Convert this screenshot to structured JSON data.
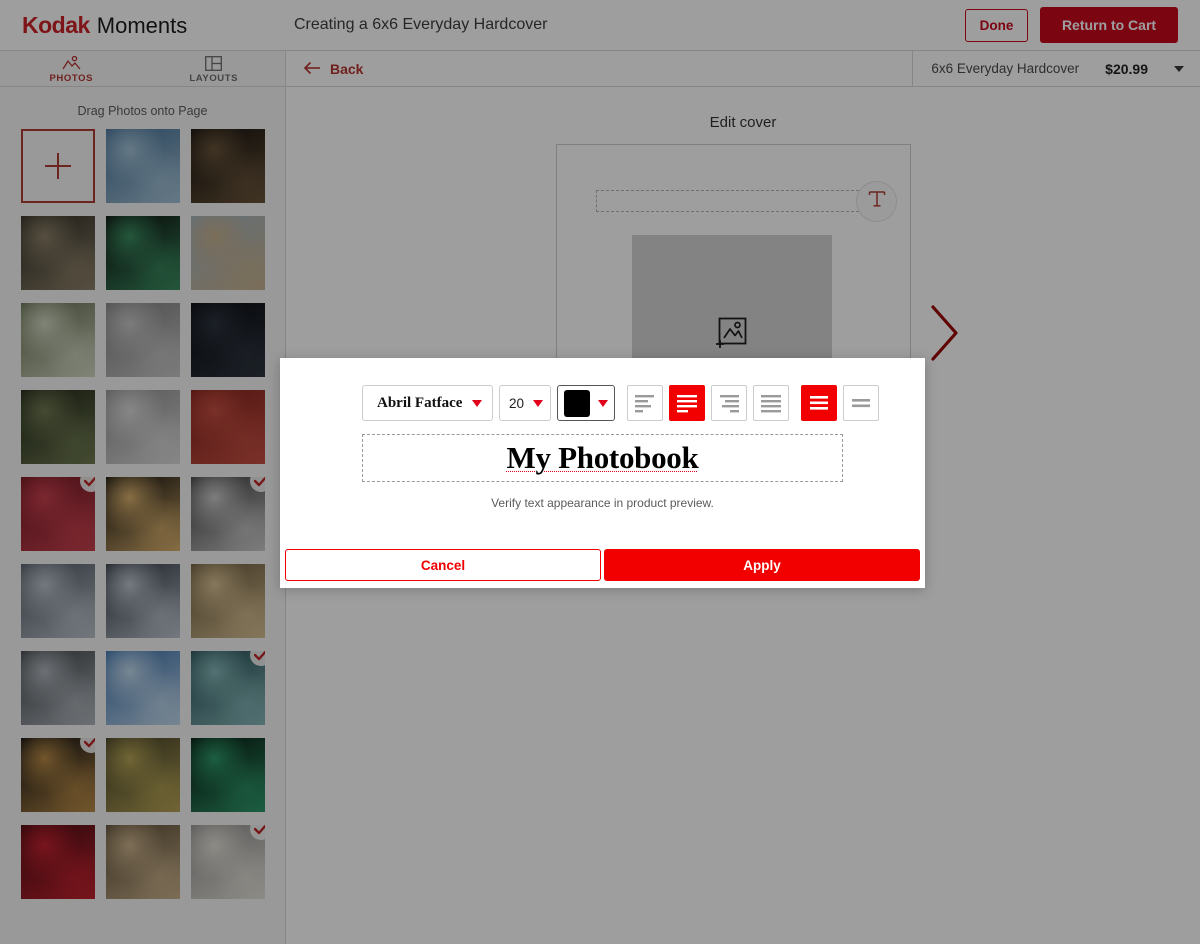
{
  "header": {
    "brand_primary": "Kodak",
    "brand_secondary": "Moments",
    "title": "Creating a 6x6 Everyday Hardcover",
    "done_label": "Done",
    "cart_label": "Return to Cart",
    "accent_red": "#e2001a"
  },
  "sidebar": {
    "tabs": [
      {
        "label": "PHOTOS",
        "icon": "photos-icon",
        "active": true
      },
      {
        "label": "LAYOUTS",
        "icon": "layouts-icon",
        "active": false
      }
    ],
    "drag_hint": "Drag Photos onto Page",
    "add_tile_icon": "plus-icon",
    "thumbnails": [
      {
        "name": "add-photos-tile",
        "kind": "add",
        "used": false
      },
      {
        "name": "thumb-blue-mosaic",
        "kind": "photo",
        "used": false,
        "c1": "#3b6e9c",
        "c2": "#9dc2da",
        "style": "noise-blue"
      },
      {
        "name": "thumb-city-skyline-night",
        "kind": "photo",
        "used": false,
        "c1": "#120e0c",
        "c2": "#6b5334",
        "style": "city-night"
      },
      {
        "name": "thumb-guitar-hands",
        "kind": "photo",
        "used": false,
        "c1": "#2e2a22",
        "c2": "#8d7f63",
        "style": "guitar"
      },
      {
        "name": "thumb-green-bokeh",
        "kind": "photo",
        "used": false,
        "c1": "#0a0a0a",
        "c2": "#2f8f5b",
        "style": "bokeh-green"
      },
      {
        "name": "thumb-horse-mane",
        "kind": "photo",
        "used": false,
        "c1": "#9fb6c4",
        "c2": "#c9b089",
        "style": "horse"
      },
      {
        "name": "thumb-dandelion",
        "kind": "photo",
        "used": false,
        "c1": "#5f6b4a",
        "c2": "#cfd6bd",
        "style": "dandelion"
      },
      {
        "name": "thumb-heart-sculpture",
        "kind": "photo",
        "used": false,
        "c1": "#7d7d7d",
        "c2": "#c6c6c6",
        "style": "hearts"
      },
      {
        "name": "thumb-dark-portrait",
        "kind": "photo",
        "used": false,
        "c1": "#07090f",
        "c2": "#2b3440",
        "style": "dark"
      },
      {
        "name": "thumb-forest-path",
        "kind": "photo",
        "used": false,
        "c1": "#1c2414",
        "c2": "#6d7a4a",
        "style": "forest"
      },
      {
        "name": "thumb-wind-turbines",
        "kind": "photo",
        "used": false,
        "c1": "#8c8c8c",
        "c2": "#d9d9d9",
        "style": "turbines"
      },
      {
        "name": "thumb-red-door",
        "kind": "photo",
        "used": false,
        "c1": "#8f1d18",
        "c2": "#d44a3a",
        "style": "reddoor"
      },
      {
        "name": "thumb-red-texture",
        "kind": "photo",
        "used": true,
        "c1": "#7d1320",
        "c2": "#d93a4a",
        "style": "redtex"
      },
      {
        "name": "thumb-warm-bokeh",
        "kind": "photo",
        "used": false,
        "c1": "#0c0c0c",
        "c2": "#e0b060",
        "style": "bokeh-warm"
      },
      {
        "name": "thumb-elder-portrait",
        "kind": "photo",
        "used": true,
        "c1": "#3a3a3a",
        "c2": "#c9c9c9",
        "style": "gray"
      },
      {
        "name": "thumb-space-needle",
        "kind": "photo",
        "used": false,
        "c1": "#4a5560",
        "c2": "#b8c2cc",
        "style": "needle"
      },
      {
        "name": "thumb-woman-stripes",
        "kind": "photo",
        "used": false,
        "c1": "#2c3540",
        "c2": "#b9c4cf",
        "style": "stripes"
      },
      {
        "name": "thumb-food-board",
        "kind": "photo",
        "used": false,
        "c1": "#6b5433",
        "c2": "#d9c08a",
        "style": "food"
      },
      {
        "name": "thumb-open-road",
        "kind": "photo",
        "used": false,
        "c1": "#3a3f45",
        "c2": "#aeb6bd",
        "style": "road"
      },
      {
        "name": "thumb-blue-sky",
        "kind": "photo",
        "used": false,
        "c1": "#2f6fb5",
        "c2": "#bcd8f0",
        "style": "sky"
      },
      {
        "name": "thumb-hands-teal",
        "kind": "photo",
        "used": true,
        "c1": "#1d4b52",
        "c2": "#7fb9ba",
        "style": "teal"
      },
      {
        "name": "thumb-city-reflection",
        "kind": "photo",
        "used": true,
        "c1": "#070a10",
        "c2": "#c08a3a",
        "style": "reflect"
      },
      {
        "name": "thumb-autumn-stream",
        "kind": "photo",
        "used": false,
        "c1": "#3e3a22",
        "c2": "#b8a347",
        "style": "autumn"
      },
      {
        "name": "thumb-green-abstract",
        "kind": "photo",
        "used": false,
        "c1": "#04120c",
        "c2": "#1f9c64",
        "style": "greenabs"
      },
      {
        "name": "thumb-red-lines",
        "kind": "photo",
        "used": false,
        "c1": "#4a0a10",
        "c2": "#d81b2a",
        "style": "redlines"
      },
      {
        "name": "thumb-dog-yorkie",
        "kind": "photo",
        "used": false,
        "c1": "#5a4830",
        "c2": "#cdb183",
        "style": "dog"
      },
      {
        "name": "thumb-pencil-notebook",
        "kind": "photo",
        "used": true,
        "c1": "#8d8d8d",
        "c2": "#e4e0d6",
        "style": "pencil"
      }
    ]
  },
  "subbar": {
    "back_label": "Back",
    "back_icon": "arrow-left-icon",
    "product_name": "6x6 Everyday Hardcover",
    "product_price": "$20.99",
    "price_caret_icon": "chevron-down-icon"
  },
  "canvas": {
    "title": "Edit cover",
    "text_tool_icon": "text-tool-icon",
    "photo_placeholder_icon": "add-image-icon",
    "next_page_icon": "chevron-right-icon"
  },
  "modal": {
    "font": {
      "value": "Abril Fatface",
      "caret_icon": "caret-down-icon"
    },
    "size": {
      "value": "20",
      "caret_icon": "caret-down-icon"
    },
    "color": {
      "value": "#000000",
      "caret_icon": "caret-down-icon"
    },
    "align_buttons": [
      {
        "name": "align-left-ragged-icon",
        "active": false
      },
      {
        "name": "align-left-icon",
        "active": true
      },
      {
        "name": "align-right-icon",
        "active": false
      },
      {
        "name": "align-justify-icon",
        "active": false
      }
    ],
    "vertical_align_buttons": [
      {
        "name": "valign-top-icon",
        "active": true
      },
      {
        "name": "valign-middle-icon",
        "active": false
      }
    ],
    "preview_text": "My Photobook",
    "hint": "Verify text appearance in product preview.",
    "cancel_label": "Cancel",
    "apply_label": "Apply",
    "button_red": "#f20000"
  }
}
